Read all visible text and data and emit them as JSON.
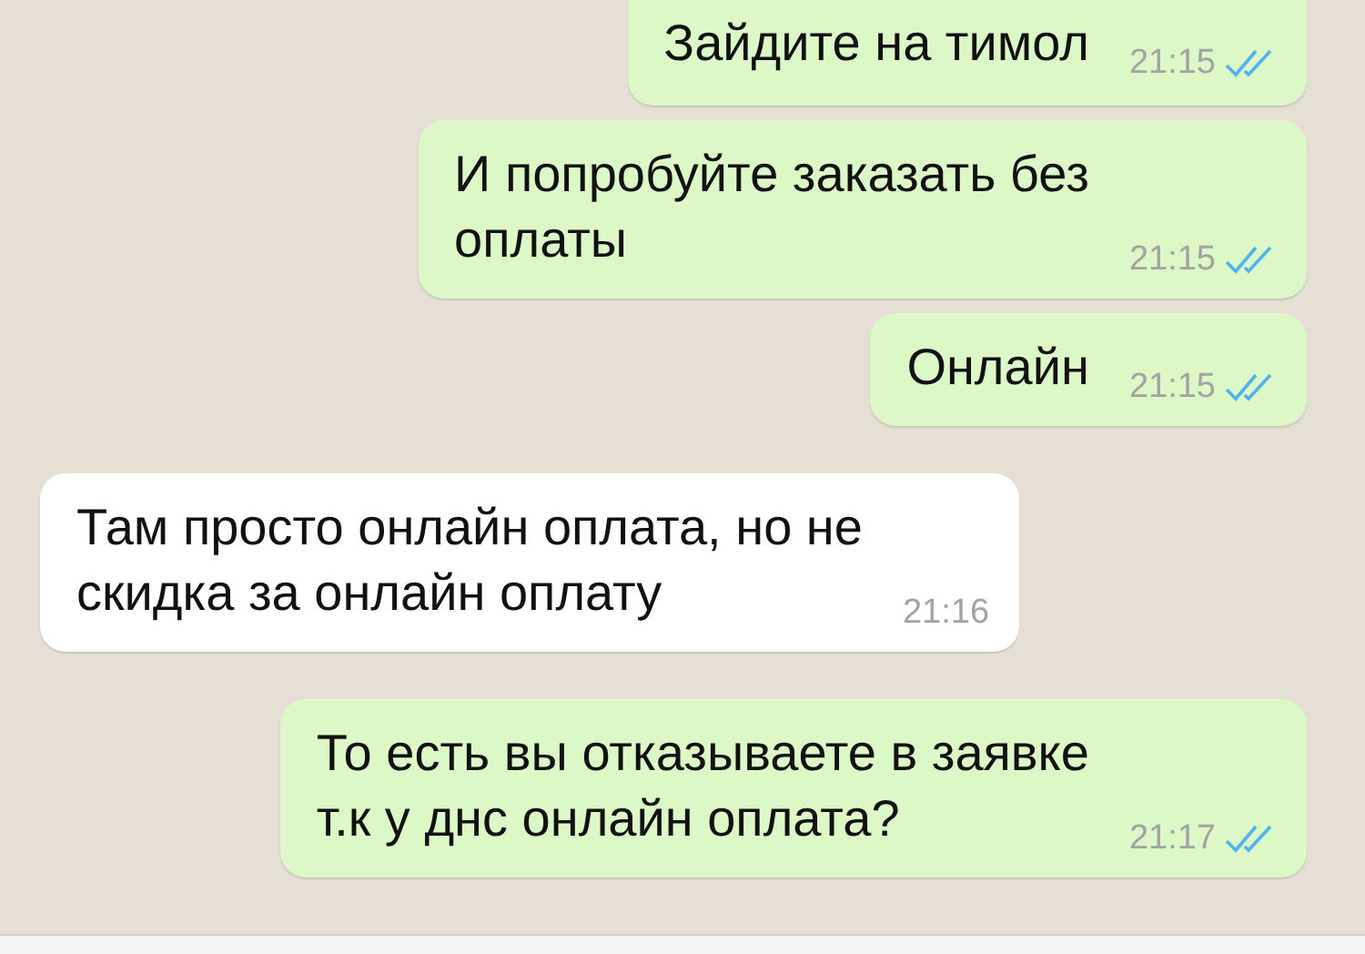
{
  "messages": [
    {
      "outgoing": true,
      "text": "Зайдите на тимол",
      "time": "21:15",
      "read": true
    },
    {
      "outgoing": true,
      "text": "И попробуйте заказать без\nоплаты",
      "time": "21:15",
      "read": true
    },
    {
      "outgoing": true,
      "text": "Онлайн",
      "time": "21:15",
      "read": true
    },
    {
      "outgoing": false,
      "text": "Там просто онлайн оплата, но не\nскидка за онлайн оплату",
      "time": "21:16"
    },
    {
      "outgoing": true,
      "text": "То есть вы отказываете в заявке\nт.к у днс онлайн оплата?",
      "time": "21:17",
      "read": true
    }
  ]
}
